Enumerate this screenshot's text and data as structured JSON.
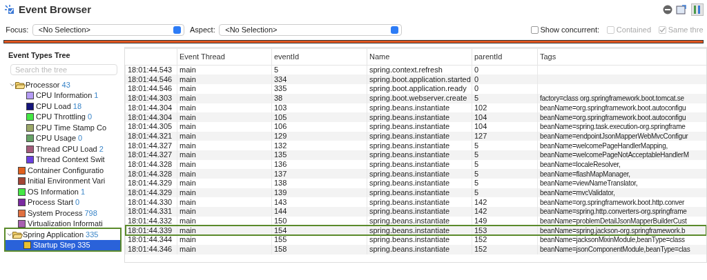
{
  "window": {
    "title": "Event Browser"
  },
  "toolbar": {
    "focus": {
      "label": "Focus:",
      "value": "<No Selection>"
    },
    "aspect": {
      "label": "Aspect:",
      "value": "<No Selection>"
    },
    "options": [
      {
        "label": "Show concurrent:",
        "checked": false,
        "disabled": false
      },
      {
        "label": "Contained",
        "checked": false,
        "disabled": true
      },
      {
        "label": "Same thre",
        "checked": true,
        "disabled": true
      }
    ]
  },
  "tree": {
    "title": "Event Types Tree",
    "search": {
      "placeholder": "Search the tree"
    },
    "items": [
      {
        "kind": "offscreen",
        "children": [
          {
            "kind": "folder",
            "label": "Processor",
            "count": "43",
            "expanded": true,
            "children": [
              {
                "kind": "type",
                "label": "CPU Information",
                "count": "1",
                "color": "#b59cf5",
                "selected": false
              },
              {
                "kind": "type",
                "label": "CPU Load",
                "count": "18",
                "color": "#14147a",
                "selected": false
              },
              {
                "kind": "type",
                "label": "CPU Throttling",
                "count": "0",
                "color": "#44e844",
                "selected": false
              },
              {
                "kind": "type",
                "label": "CPU Time Stamp Co",
                "color": "#9ba868",
                "selected": false
              },
              {
                "kind": "type",
                "label": "CPU Usage",
                "count": "0",
                "color": "#66a366",
                "selected": false
              },
              {
                "kind": "type",
                "label": "Thread CPU Load",
                "count": "2",
                "color": "#a35a7a",
                "selected": false
              },
              {
                "kind": "type",
                "label": "Thread Context Swit",
                "color": "#6a3fe0",
                "selected": false
              }
            ]
          },
          {
            "kind": "type",
            "label": "Container Configuratio",
            "color": "#e0601e",
            "selected": false
          },
          {
            "kind": "type",
            "label": "Initial Environment Vari",
            "color": "#a34535",
            "selected": false
          },
          {
            "kind": "type",
            "label": "OS Information",
            "count": "1",
            "color": "#44e844",
            "selected": false
          },
          {
            "kind": "type",
            "label": "Process Start",
            "count": "0",
            "color": "#7a2aa0",
            "selected": false
          },
          {
            "kind": "type",
            "label": "System Process",
            "count": "798",
            "color": "#e07040",
            "selected": false
          },
          {
            "kind": "type",
            "label": "Virtualization Informati",
            "color": "#a860b0",
            "selected": false
          }
        ]
      },
      {
        "kind": "folder",
        "label": "Spring Application",
        "count": "335",
        "expanded": true,
        "framed": true,
        "children": [
          {
            "kind": "type",
            "label": "Startup Step",
            "count": "335",
            "color": "#e8c030",
            "selected": true
          }
        ]
      }
    ]
  },
  "table": {
    "columns": [
      "",
      "Event Thread",
      "eventId",
      "Name",
      "parentId",
      "Tags"
    ],
    "rows": [
      {
        "cells": [
          "18:01:44.543",
          "main",
          "5",
          "spring.context.refresh",
          "0",
          ""
        ],
        "framed": false
      },
      {
        "cells": [
          "18:01:44.546",
          "main",
          "334",
          "spring.boot.application.started",
          "0",
          ""
        ],
        "framed": false
      },
      {
        "cells": [
          "18:01:44.546",
          "main",
          "335",
          "spring.boot.application.ready",
          "0",
          ""
        ],
        "framed": false
      },
      {
        "cells": [
          "18:01:44.303",
          "main",
          "38",
          "spring.boot.webserver.create",
          "5",
          "factory=class org.springframework.boot.tomcat.se"
        ],
        "framed": false
      },
      {
        "cells": [
          "18:01:44.304",
          "main",
          "103",
          "spring.beans.instantiate",
          "102",
          "beanName=org.springframework.boot.autoconfigu"
        ],
        "framed": false
      },
      {
        "cells": [
          "18:01:44.304",
          "main",
          "105",
          "spring.beans.instantiate",
          "104",
          "beanName=org.springframework.boot.autoconfigu"
        ],
        "framed": false
      },
      {
        "cells": [
          "18:01:44.305",
          "main",
          "106",
          "spring.beans.instantiate",
          "104",
          "beanName=spring.task.execution-org.springframe"
        ],
        "framed": false
      },
      {
        "cells": [
          "18:01:44.321",
          "main",
          "129",
          "spring.beans.instantiate",
          "127",
          "beanName=endpointJsonMapperWebMvcConfigur"
        ],
        "framed": false
      },
      {
        "cells": [
          "18:01:44.327",
          "main",
          "132",
          "spring.beans.instantiate",
          "5",
          "beanName=welcomePageHandlerMapping,"
        ],
        "framed": false
      },
      {
        "cells": [
          "18:01:44.327",
          "main",
          "135",
          "spring.beans.instantiate",
          "5",
          "beanName=welcomePageNotAcceptableHandlerM"
        ],
        "framed": false
      },
      {
        "cells": [
          "18:01:44.328",
          "main",
          "136",
          "spring.beans.instantiate",
          "5",
          "beanName=localeResolver,"
        ],
        "framed": false
      },
      {
        "cells": [
          "18:01:44.328",
          "main",
          "137",
          "spring.beans.instantiate",
          "5",
          "beanName=flashMapManager,"
        ],
        "framed": false
      },
      {
        "cells": [
          "18:01:44.329",
          "main",
          "138",
          "spring.beans.instantiate",
          "5",
          "beanName=viewNameTranslator,"
        ],
        "framed": false
      },
      {
        "cells": [
          "18:01:44.329",
          "main",
          "139",
          "spring.beans.instantiate",
          "5",
          "beanName=mvcValidator,"
        ],
        "framed": false
      },
      {
        "cells": [
          "18:01:44.330",
          "main",
          "143",
          "spring.beans.instantiate",
          "142",
          "beanName=org.springframework.boot.http.conver"
        ],
        "framed": false
      },
      {
        "cells": [
          "18:01:44.331",
          "main",
          "144",
          "spring.beans.instantiate",
          "142",
          "beanName=spring.http.converters-org.springframe"
        ],
        "framed": false
      },
      {
        "cells": [
          "18:01:44.332",
          "main",
          "150",
          "spring.beans.instantiate",
          "149",
          "beanName=problemDetailJsonMapperBuilderCust"
        ],
        "framed": false
      },
      {
        "cells": [
          "18:01:44.339",
          "main",
          "154",
          "spring.beans.instantiate",
          "153",
          "beanName=spring.jackson-org.springframework.b"
        ],
        "framed": true
      },
      {
        "cells": [
          "18:01:44.344",
          "main",
          "155",
          "spring.beans.instantiate",
          "152",
          "beanName=jacksonMixinModule,beanType=class"
        ],
        "framed": false
      },
      {
        "cells": [
          "18:01:44.346",
          "main",
          "158",
          "spring.beans.instantiate",
          "152",
          "beanName=jsonComponentModule,beanType=clas"
        ],
        "framed": false
      }
    ]
  }
}
